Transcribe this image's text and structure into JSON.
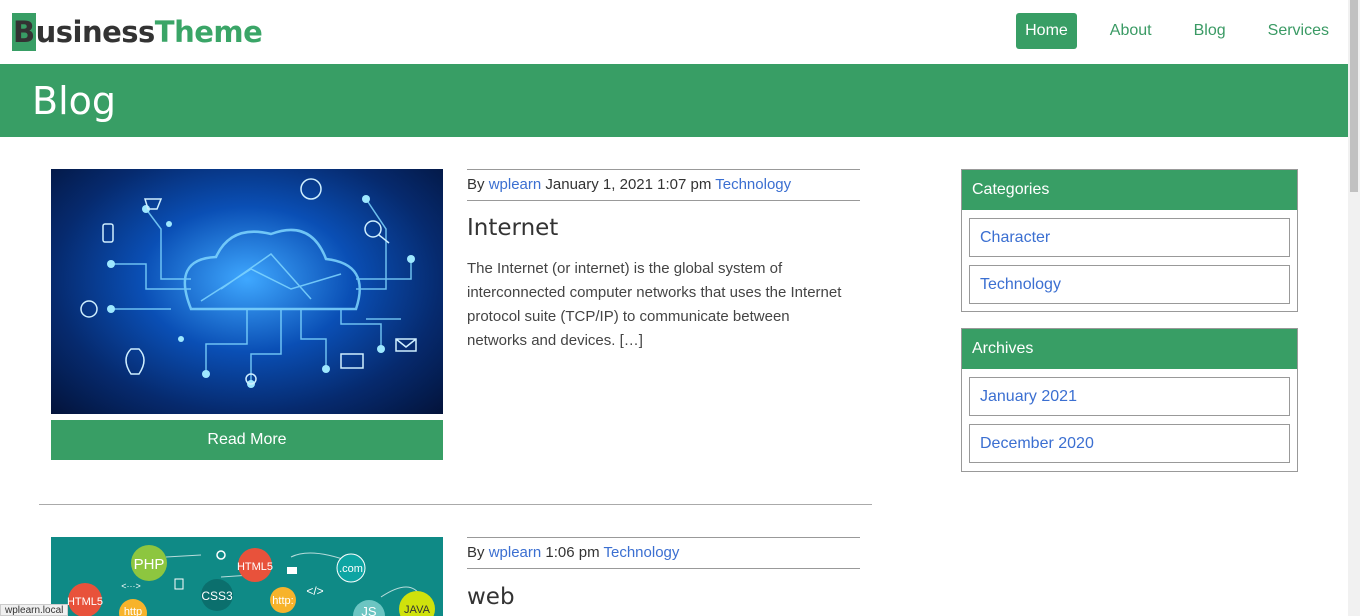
{
  "header": {
    "logo_b": "B",
    "logo_rest1": "usiness",
    "logo_rest2": "Theme",
    "nav": [
      "Home",
      "About",
      "Blog",
      "Services"
    ]
  },
  "banner": {
    "title": "Blog"
  },
  "posts": [
    {
      "meta_by": "By",
      "author": "wplearn",
      "date": "January 1, 2021 1:07 pm",
      "category": "Technology",
      "title": "Internet",
      "excerpt": "The Internet (or internet) is the global system of interconnected computer networks that uses the Internet protocol suite (TCP/IP) to communicate between networks and devices. […]",
      "read_more": "Read More"
    },
    {
      "meta_by": "By",
      "author": "wplearn",
      "date": "1:06 pm",
      "category": "Technology",
      "title": "web",
      "image_badges": [
        "PHP",
        "HTML5",
        ".com",
        "HTML5",
        "CSS3",
        "http:",
        "JS",
        "JAVA",
        "http",
        "</>",
        "<···>"
      ]
    }
  ],
  "sidebar": {
    "categories_title": "Categories",
    "categories": [
      "Character",
      "Technology"
    ],
    "archives_title": "Archives",
    "archives": [
      "January 2021",
      "December 2020"
    ]
  },
  "statusbar": {
    "text": "wplearn.local"
  },
  "colors": {
    "brand_green": "#389e65",
    "link_blue": "#3b6fd1"
  }
}
